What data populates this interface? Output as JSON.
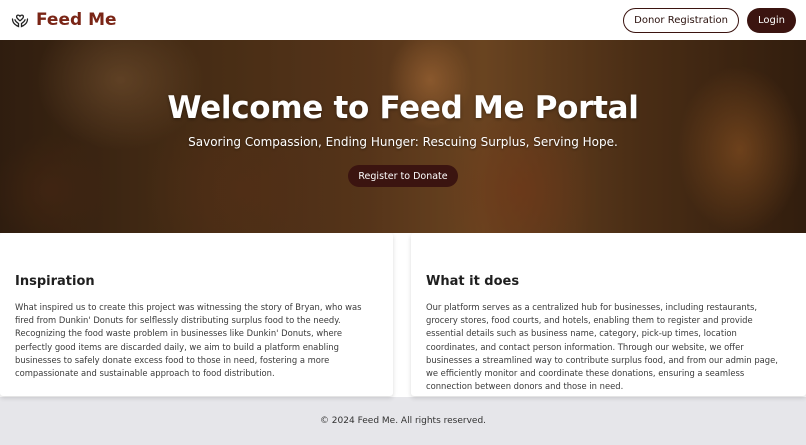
{
  "nav": {
    "brand_icon": "heart-hands-icon",
    "brand": "Feed Me",
    "donor_registration": "Donor Registration",
    "login": "Login"
  },
  "hero": {
    "title": "Welcome to Feed Me Portal",
    "subtitle": "Savoring Compassion, Ending Hunger: Rescuing Surplus, Serving Hope.",
    "cta": "Register to Donate"
  },
  "sections": {
    "inspiration": {
      "title": "Inspiration",
      "body": "What inspired us to create this project was witnessing the story of Bryan, who was fired from Dunkin' Donuts for selflessly distributing surplus food to the needy. Recognizing the food waste problem in businesses like Dunkin' Donuts, where perfectly good items are discarded daily, we aim to build a platform enabling businesses to safely donate excess food to those in need, fostering a more compassionate and sustainable approach to food distribution."
    },
    "what_it_does": {
      "title": "What it does",
      "body": "Our platform serves as a centralized hub for businesses, including restaurants, grocery stores, food courts, and hotels, enabling them to register and provide essential details such as business name, category, pick-up times, location coordinates, and contact person information. Through our website, we offer businesses a streamlined way to contribute surplus food, and from our admin page, we efficiently monitor and coordinate these donations, ensuring a seamless connection between donors and those in need."
    }
  },
  "footer": {
    "text": "© 2024 Feed Me. All rights reserved."
  },
  "colors": {
    "brand": "#7a2516",
    "primary_dark": "#3b1410",
    "footer_bg": "#e6e6ea"
  }
}
